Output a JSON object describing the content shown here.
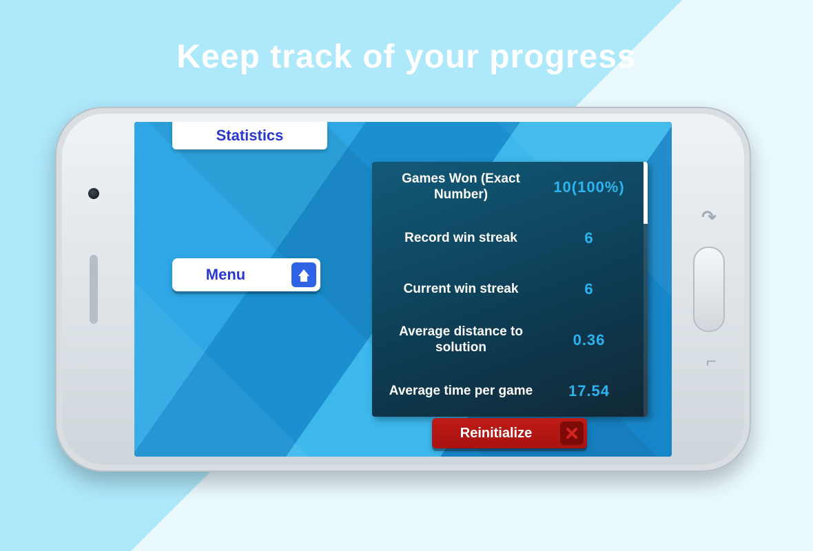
{
  "headline": "Keep track of your progress",
  "screen": {
    "tab_label": "Statistics",
    "menu": {
      "label": "Menu",
      "icon": "home-icon"
    },
    "reinit_label": "Reinitialize",
    "stats": [
      {
        "label": "Games Won (Exact Number)",
        "value": "10(100%)"
      },
      {
        "label": "Record win streak",
        "value": "6"
      },
      {
        "label": "Current win streak",
        "value": "6"
      },
      {
        "label": "Average distance to solution",
        "value": "0.36"
      },
      {
        "label": "Average time per game",
        "value": "17.54"
      }
    ]
  }
}
